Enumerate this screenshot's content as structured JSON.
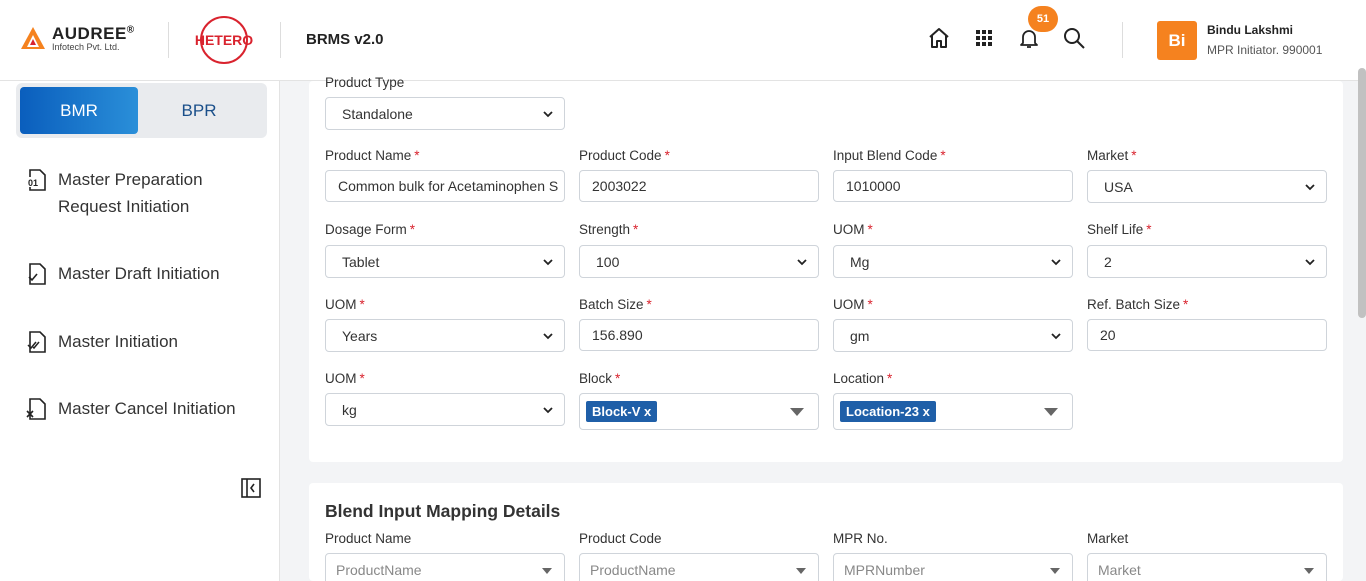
{
  "header": {
    "brand_name": "AUDREE",
    "brand_reg": "®",
    "brand_sub": "Infotech Pvt. Ltd.",
    "partner_logo": "HETERO",
    "app_title": "BRMS v2.0",
    "notification_count": "51",
    "user": {
      "initials": "Bi",
      "name": "Bindu Lakshmi",
      "role": "MPR Initiator. 990001"
    }
  },
  "sidebar": {
    "tabs": [
      {
        "label": "BMR",
        "active": true
      },
      {
        "label": "BPR",
        "active": false
      }
    ],
    "items": [
      {
        "line1": "Master Preparation",
        "line2": "Request Initiation",
        "icon": "document-number-icon"
      },
      {
        "line1": "Master Draft Initiation",
        "icon": "document-check-icon"
      },
      {
        "line1": "Master Initiation",
        "icon": "document-double-check-icon"
      },
      {
        "line1": "Master Cancel Initiation",
        "icon": "document-cancel-icon"
      }
    ]
  },
  "form": {
    "product_type": {
      "label": "Product Type",
      "value": "Standalone"
    },
    "product_name": {
      "label": "Product Name",
      "value": "Common bulk for Acetaminophen S"
    },
    "product_code": {
      "label": "Product Code",
      "value": "2003022"
    },
    "input_blend_code": {
      "label": "Input Blend Code",
      "value": "1010000"
    },
    "market": {
      "label": "Market",
      "value": "USA"
    },
    "dosage_form": {
      "label": "Dosage Form",
      "value": "Tablet"
    },
    "strength": {
      "label": "Strength",
      "value": "100"
    },
    "uom_strength": {
      "label": "UOM",
      "value": "Mg"
    },
    "shelf_life": {
      "label": "Shelf Life",
      "value": "2"
    },
    "uom_shelf": {
      "label": "UOM",
      "value": "Years"
    },
    "batch_size": {
      "label": "Batch Size",
      "value": "156.890"
    },
    "uom_batch": {
      "label": "UOM",
      "value": "gm"
    },
    "ref_batch_size": {
      "label": "Ref. Batch Size",
      "value": "20"
    },
    "uom_ref": {
      "label": "UOM",
      "value": "kg"
    },
    "block": {
      "label": "Block",
      "tag": "Block-V",
      "remove": "x"
    },
    "location": {
      "label": "Location",
      "tag": "Location-23",
      "remove": "x"
    },
    "required_mark": "*"
  },
  "blend_section": {
    "title": "Blend Input Mapping Details",
    "product_name": {
      "label": "Product Name",
      "placeholder": "ProductName"
    },
    "product_code": {
      "label": "Product Code",
      "placeholder": "ProductName"
    },
    "mpr_no": {
      "label": "MPR No.",
      "placeholder": "MPRNumber"
    },
    "market": {
      "label": "Market",
      "placeholder": "Market"
    }
  },
  "colors": {
    "accent_orange": "#f5821f",
    "primary_blue": "#0a5ebd",
    "tag_blue": "#1f5fa8",
    "required_red": "#d9232e"
  }
}
